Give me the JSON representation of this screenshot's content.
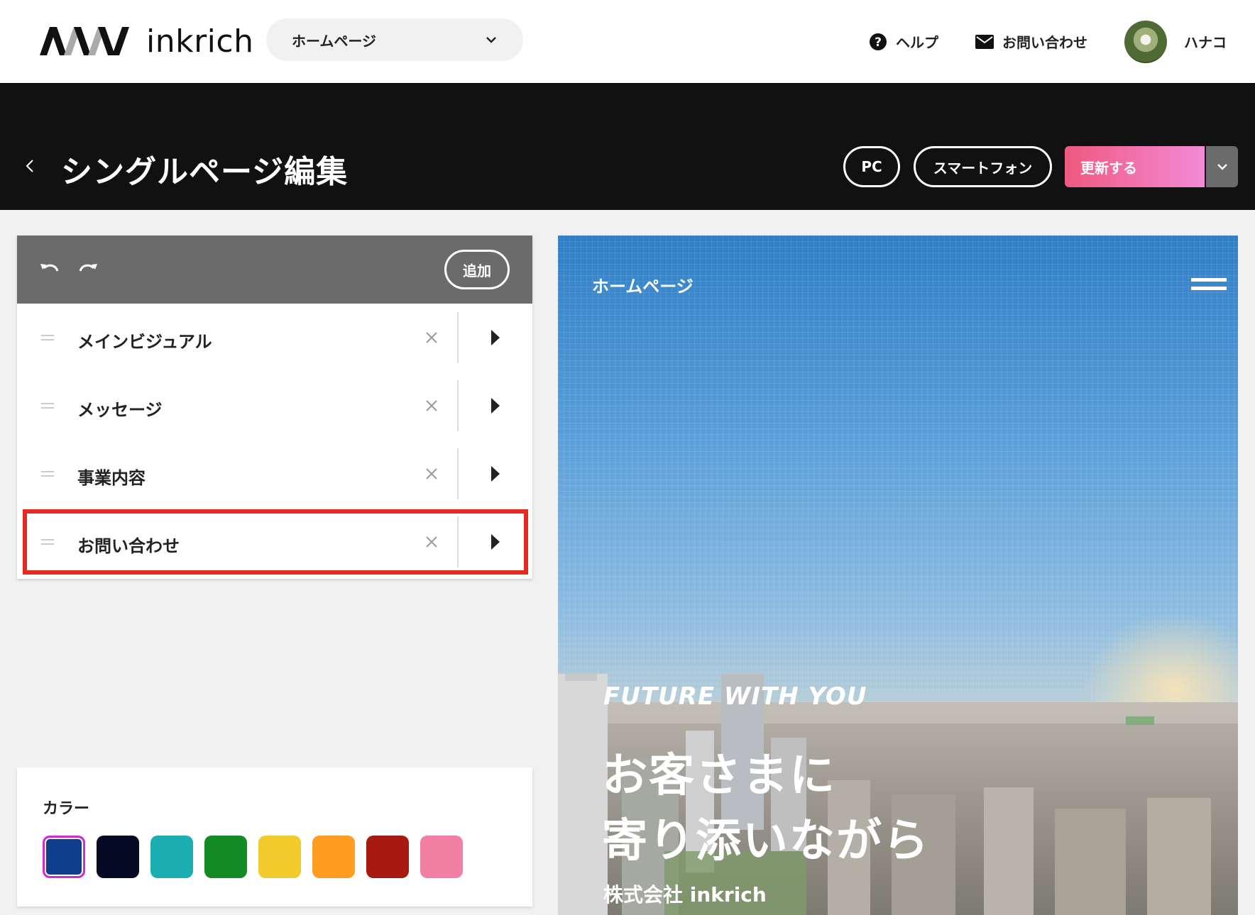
{
  "header": {
    "logo_text": "inkrich",
    "page_select": "ホームページ",
    "help": "ヘルプ",
    "contact": "お問い合わせ",
    "user_name": "ハナコ"
  },
  "titlebar": {
    "title": "シングルページ編集",
    "view_pc": "PC",
    "view_sp": "スマートフォン",
    "update": "更新する"
  },
  "sections": {
    "add_label": "追加",
    "items": [
      {
        "label": "メインビジュアル"
      },
      {
        "label": "メッセージ"
      },
      {
        "label": "事業内容"
      },
      {
        "label": "お問い合わせ",
        "highlighted": true
      }
    ]
  },
  "colors": {
    "title": "カラー",
    "swatches": [
      "#0f3e8c",
      "#050a24",
      "#1aaeb3",
      "#138a24",
      "#f2ca2b",
      "#ff9c22",
      "#a81911",
      "#f27fa4"
    ],
    "selected_index": 0,
    "selected_border": "#d12bd1"
  },
  "preview": {
    "site_title": "ホームページ",
    "tagline": "FUTURE WITH YOU",
    "headline_1": "お客さまに",
    "headline_2": "寄り添いながら",
    "company": "株式会社 inkrich"
  }
}
